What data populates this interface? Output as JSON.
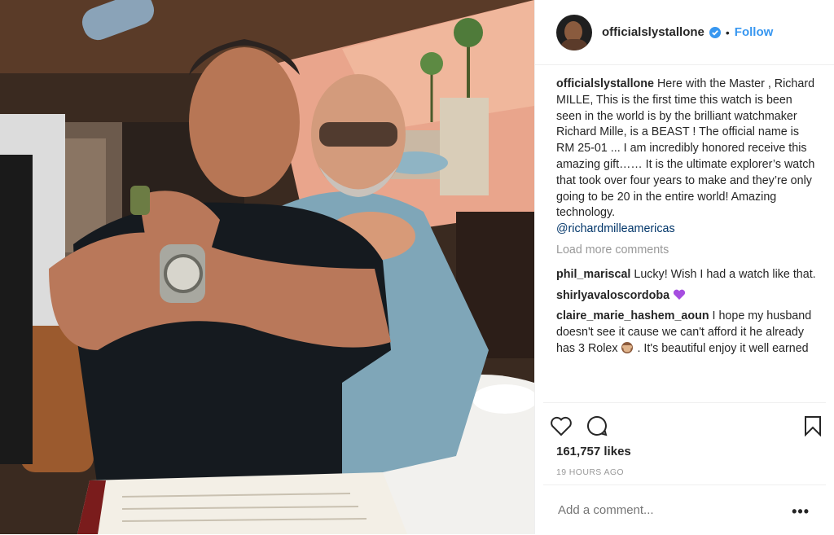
{
  "header": {
    "username": "officialslystallone",
    "separator": "•",
    "follow_label": "Follow"
  },
  "caption": {
    "username": "officialslystallone",
    "text": " Here with the Master , Richard MILLE, This is the first time this watch is been seen in the world is by the brilliant watchmaker Richard Mille, is a BEAST ! The official name is RM 25-01 ... I am incredibly honored receive this amazing gift…… It is the ultimate explorer’s watch that took over four years to make and they’re only going to be 20 in the entire world! Amazing technology.",
    "mention": "@richardmilleamericas"
  },
  "load_more": "Load more comments",
  "comments": [
    {
      "username": "phil_mariscal",
      "text": " Lucky! Wish I had a watch like that."
    },
    {
      "username": "shirlyavaloscordoba",
      "text": " ",
      "emoji": "purple-heart"
    },
    {
      "username": "claire_marie_hashem_aoun",
      "text": " I hope my husband doesn't see it cause we can't afford it he already has 3 Rolex ",
      "emoji": "see-no-evil-monkey",
      "text_after": " . It's beautiful enjoy it well earned"
    }
  ],
  "likes": "161,757 likes",
  "timestamp": "19 HOURS AGO",
  "add_comment": {
    "placeholder": "Add a comment..."
  },
  "more_label": "•••",
  "icons": [
    "heart-icon",
    "comment-icon",
    "bookmark-icon",
    "verified-badge-icon"
  ],
  "colors": {
    "accent": "#3897f0",
    "verified": "#3897f0",
    "muted": "#999999",
    "mention": "#003569"
  }
}
